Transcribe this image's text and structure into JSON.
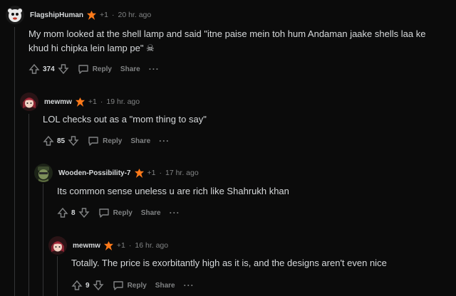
{
  "colors": {
    "background": "#0b0b0b",
    "text": "#d7dadc",
    "muted": "#818384",
    "thread_line": "#343536",
    "badge": "#ff7a1a"
  },
  "comments": [
    {
      "username": "FlagshipHuman",
      "karma": "+1",
      "time": "20 hr. ago",
      "body_line1": "My mom looked at the shell lamp and said \"itne paise mein toh hum Andaman jaake shells laa ke",
      "body_line2": "khud hi chipka lein lamp pe\" ☠",
      "score": "374",
      "reply_label": "Reply",
      "share_label": "Share",
      "more_label": "···"
    },
    {
      "username": "mewmw",
      "karma": "+1",
      "time": "19 hr. ago",
      "body_line1": "LOL checks out as a \"mom thing to say\"",
      "score": "85",
      "reply_label": "Reply",
      "share_label": "Share",
      "more_label": "···"
    },
    {
      "username": "Wooden-Possibility-7",
      "karma": "+1",
      "time": "17 hr. ago",
      "body_line1": "Its common sense uneless u are rich like Shahrukh khan",
      "score": "8",
      "reply_label": "Reply",
      "share_label": "Share",
      "more_label": "···"
    },
    {
      "username": "mewmw",
      "karma": "+1",
      "time": "16 hr. ago",
      "body_line1": "Totally. The price is exorbitantly high as it is, and the designs aren't even nice",
      "score": "9",
      "reply_label": "Reply",
      "share_label": "Share",
      "more_label": "···"
    }
  ]
}
